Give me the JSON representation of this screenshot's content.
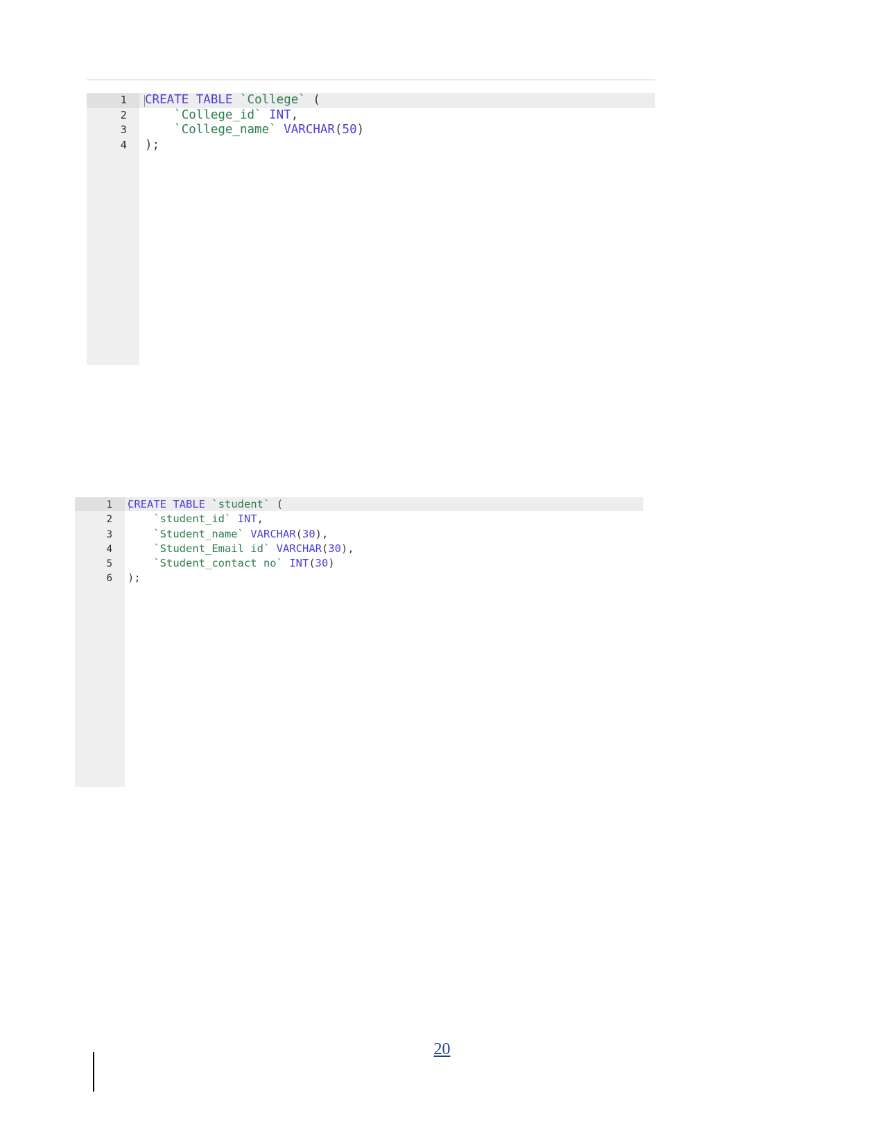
{
  "document": {
    "page_number": "20",
    "colors": {
      "keyword": "#4a3fd4",
      "identifier": "#2e7d4f",
      "gutter_bg": "#efefef",
      "highlight_bg": "#ededed",
      "page_number": "#1f3f8f",
      "rule": "#e8e8e8"
    }
  },
  "code_blocks": [
    {
      "id": "college",
      "name": "create-table-college",
      "language": "sql",
      "lines": [
        {
          "number": "1",
          "text": "CREATE TABLE `College` (",
          "tokens": [
            {
              "t": "CREATE",
              "c": "kw"
            },
            {
              "t": " ",
              "c": "pun"
            },
            {
              "t": "TABLE",
              "c": "kw"
            },
            {
              "t": " ",
              "c": "pun"
            },
            {
              "t": "`College`",
              "c": "id"
            },
            {
              "t": " (",
              "c": "pun"
            }
          ]
        },
        {
          "number": "2",
          "text": "    `College_id` INT,",
          "tokens": [
            {
              "t": "    ",
              "c": "pun"
            },
            {
              "t": "`College_id`",
              "c": "id"
            },
            {
              "t": " ",
              "c": "pun"
            },
            {
              "t": "INT",
              "c": "type"
            },
            {
              "t": ",",
              "c": "pun"
            }
          ]
        },
        {
          "number": "3",
          "text": "    `College_name` VARCHAR(50)",
          "tokens": [
            {
              "t": "    ",
              "c": "pun"
            },
            {
              "t": "`College_name`",
              "c": "id"
            },
            {
              "t": " ",
              "c": "pun"
            },
            {
              "t": "VARCHAR",
              "c": "type"
            },
            {
              "t": "(",
              "c": "pun"
            },
            {
              "t": "50",
              "c": "num"
            },
            {
              "t": ")",
              "c": "pun"
            }
          ]
        },
        {
          "number": "4",
          "text": ");",
          "tokens": [
            {
              "t": ");",
              "c": "pun"
            }
          ]
        }
      ]
    },
    {
      "id": "student",
      "name": "create-table-student",
      "language": "sql",
      "lines": [
        {
          "number": "1",
          "text": "CREATE TABLE `student` (",
          "tokens": [
            {
              "t": "CREATE",
              "c": "kw"
            },
            {
              "t": " ",
              "c": "pun"
            },
            {
              "t": "TABLE",
              "c": "kw"
            },
            {
              "t": " ",
              "c": "pun"
            },
            {
              "t": "`student`",
              "c": "id"
            },
            {
              "t": " (",
              "c": "pun"
            }
          ]
        },
        {
          "number": "2",
          "text": "    `student_id` INT,",
          "tokens": [
            {
              "t": "    ",
              "c": "pun"
            },
            {
              "t": "`student_id`",
              "c": "id"
            },
            {
              "t": " ",
              "c": "pun"
            },
            {
              "t": "INT",
              "c": "type"
            },
            {
              "t": ",",
              "c": "pun"
            }
          ]
        },
        {
          "number": "3",
          "text": "    `Student_name` VARCHAR(30),",
          "tokens": [
            {
              "t": "    ",
              "c": "pun"
            },
            {
              "t": "`Student_name`",
              "c": "id"
            },
            {
              "t": " ",
              "c": "pun"
            },
            {
              "t": "VARCHAR",
              "c": "type"
            },
            {
              "t": "(",
              "c": "pun"
            },
            {
              "t": "30",
              "c": "num"
            },
            {
              "t": "),",
              "c": "pun"
            }
          ]
        },
        {
          "number": "4",
          "text": "    `Student_Email id` VARCHAR(30),",
          "tokens": [
            {
              "t": "    ",
              "c": "pun"
            },
            {
              "t": "`Student_Email id`",
              "c": "id"
            },
            {
              "t": " ",
              "c": "pun"
            },
            {
              "t": "VARCHAR",
              "c": "type"
            },
            {
              "t": "(",
              "c": "pun"
            },
            {
              "t": "30",
              "c": "num"
            },
            {
              "t": "),",
              "c": "pun"
            }
          ]
        },
        {
          "number": "5",
          "text": "    `Student_contact no` INT(30)",
          "tokens": [
            {
              "t": "    ",
              "c": "pun"
            },
            {
              "t": "`Student_contact no`",
              "c": "id"
            },
            {
              "t": " ",
              "c": "pun"
            },
            {
              "t": "INT",
              "c": "type"
            },
            {
              "t": "(",
              "c": "pun"
            },
            {
              "t": "30",
              "c": "num"
            },
            {
              "t": ")",
              "c": "pun"
            }
          ]
        },
        {
          "number": "6",
          "text": ");",
          "tokens": [
            {
              "t": ");",
              "c": "pun"
            }
          ]
        }
      ]
    }
  ]
}
